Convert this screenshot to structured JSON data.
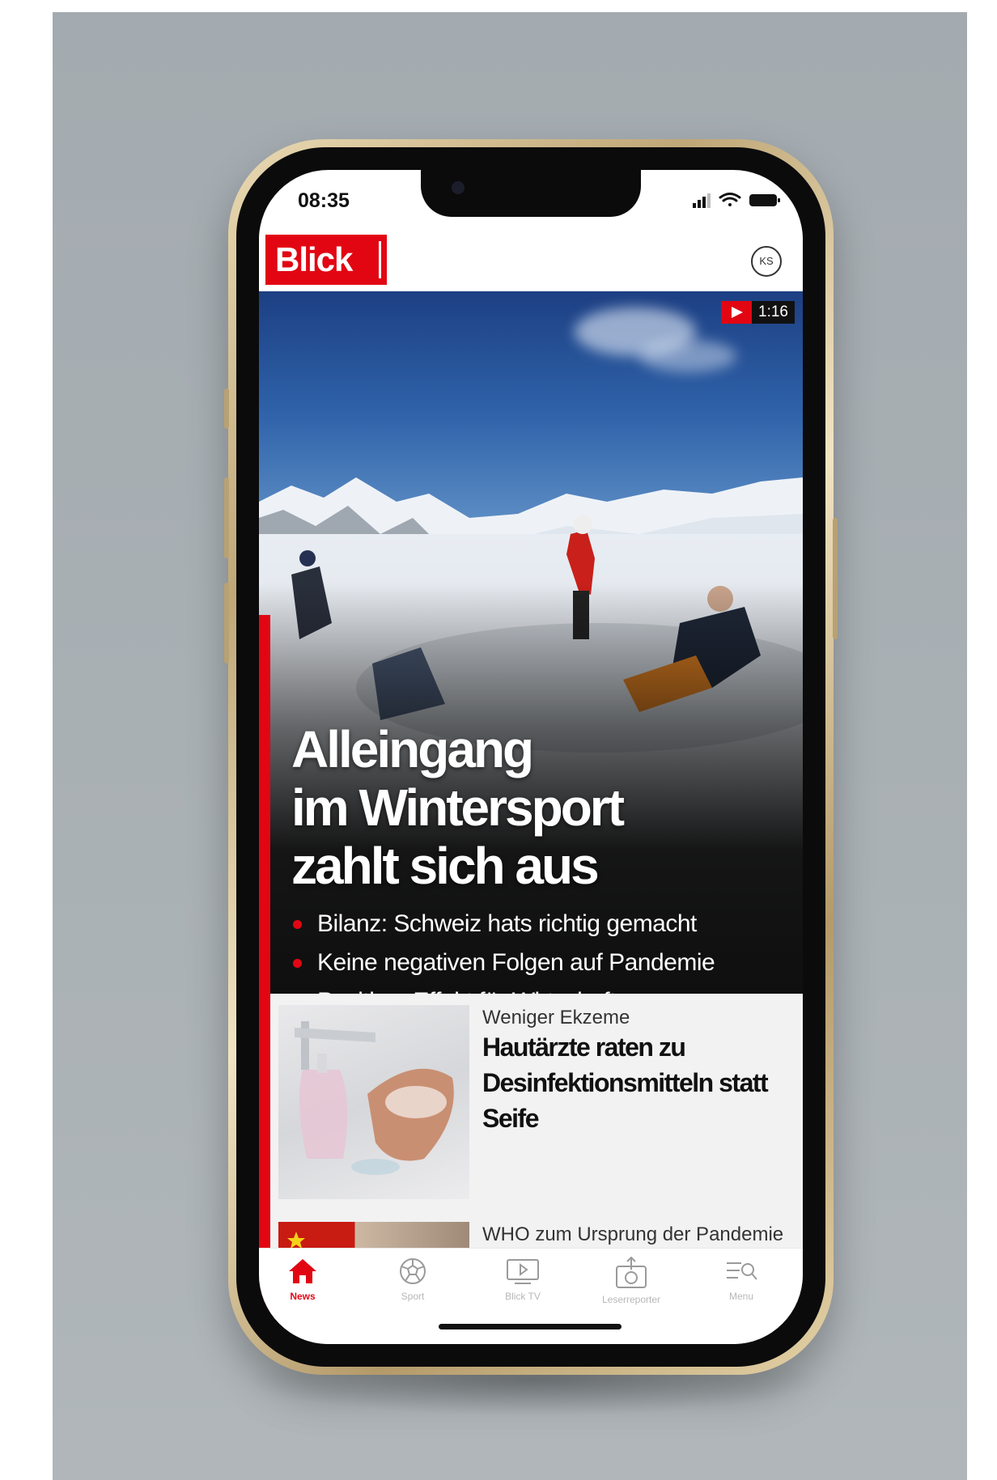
{
  "status_bar": {
    "time": "08:35"
  },
  "header": {
    "logo_text": "Blick",
    "profile_initials": "KS"
  },
  "hero": {
    "video_duration": "1:16",
    "title_lines": [
      "Alleingang",
      "im Wintersport",
      "zahlt sich aus"
    ],
    "bullets": [
      "Bilanz: Schweiz hats richtig gemacht",
      "Keine negativen Folgen auf Pandemie",
      "Positiver Effekt für Wirtschaft"
    ]
  },
  "articles": [
    {
      "kicker": "Weniger Ekzeme",
      "headline": "Hautärzte raten zu Desinfektionsmitteln statt Seife"
    },
    {
      "kicker": "WHO zum Ursprung der Pandemie",
      "headline": ""
    }
  ],
  "tabbar": {
    "items": [
      {
        "label": "News",
        "icon": "home-icon",
        "active": true
      },
      {
        "label": "Sport",
        "icon": "soccer-ball-icon",
        "active": false
      },
      {
        "label": "Blick TV",
        "icon": "tv-play-icon",
        "active": false
      },
      {
        "label": "Leserreporter",
        "icon": "camera-upload-icon",
        "active": false
      },
      {
        "label": "Menu",
        "icon": "menu-search-icon",
        "active": false
      }
    ]
  },
  "colors": {
    "brand_red": "#e20613",
    "phone_gold": "#c9b27f",
    "backdrop": "#a9b0b4"
  }
}
